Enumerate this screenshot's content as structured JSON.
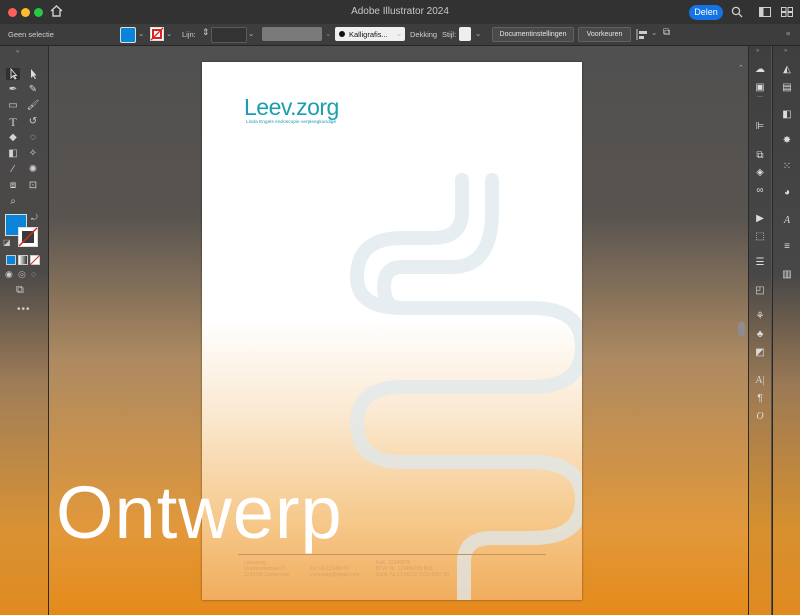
{
  "app": {
    "title": "Adobe Illustrator 2024",
    "share_label": "Delen"
  },
  "controlbar": {
    "selection": "Geen selectie",
    "stroke_label": "Lijn:",
    "brush": "Kalligrafis...",
    "opacity_label": "Dekking",
    "style_label": "Stijl:",
    "doc_settings": "Documentinstellingen",
    "preferences": "Voorkeuren"
  },
  "colors": {
    "fill": "#0a84d8",
    "accent": "#1473e6",
    "logo": "#1b9fae"
  },
  "artboard": {
    "logo_main": "Leev",
    "logo_sub": "zorg",
    "tagline": "Linda Engels endoscopie verpleegkundige",
    "footer": {
      "col1": [
        "Leev.zorg",
        "Voorbeeldstraat 21",
        "1234 AB Zoetermeer"
      ],
      "col2": [
        "",
        "Tel: 06-12345678",
        "Leev.zorg@gmail.com"
      ],
      "col3": [
        "KvK: 12345678",
        "BTW: NL 123456789 B01",
        "Bank: NL12 ABCD 0123 4567 89"
      ]
    }
  },
  "overlay": {
    "word": "Ontwerp"
  }
}
